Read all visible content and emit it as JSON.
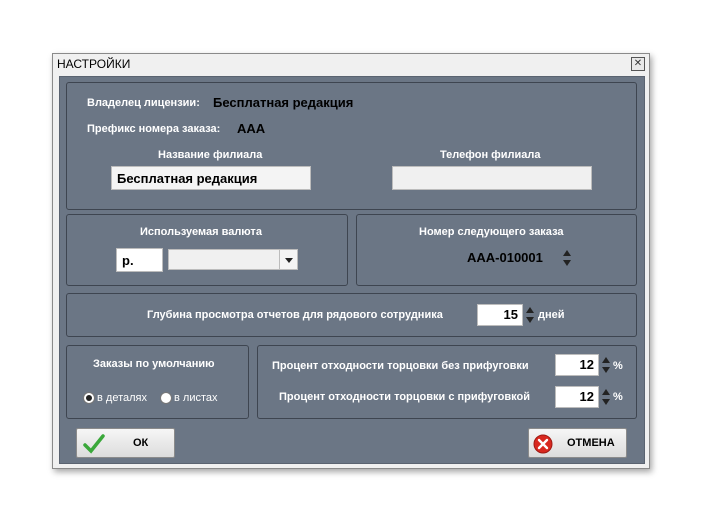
{
  "window": {
    "title": "НАСТРОЙКИ",
    "close_glyph": "✕"
  },
  "license": {
    "owner_label": "Владелец лицензии:",
    "owner_value": "Бесплатная редакция",
    "prefix_label": "Префикс номера заказа:",
    "prefix_value": "AAA"
  },
  "branch": {
    "name_label": "Название филиала",
    "name_value": "Бесплатная редакция",
    "phone_label": "Телефон филиала",
    "phone_value": ""
  },
  "currency": {
    "label": "Используемая валюта",
    "symbol_value": "р.",
    "combo_value": ""
  },
  "next_order": {
    "label": "Номер следующего заказа",
    "value": "AAA-010001"
  },
  "reports": {
    "label": "Глубина просмотра отчетов для рядового сотрудника",
    "value": "15",
    "unit": "дней"
  },
  "default_orders": {
    "label": "Заказы по умолчанию",
    "options": [
      "в деталях",
      "в листах"
    ],
    "selected": "в деталях"
  },
  "trim_waste": {
    "without_label": "Процент отходности торцовки без прифуговки",
    "without_value": "12",
    "with_label": "Процент отходности торцовки с прифуговкой",
    "with_value": "12",
    "unit": "%"
  },
  "buttons": {
    "ok_label": "ОК",
    "cancel_label": "ОТМЕНА"
  },
  "icons": {
    "ok": "check-icon",
    "cancel": "cancel-circle-icon",
    "spinner": "spinner-arrows-icon"
  }
}
